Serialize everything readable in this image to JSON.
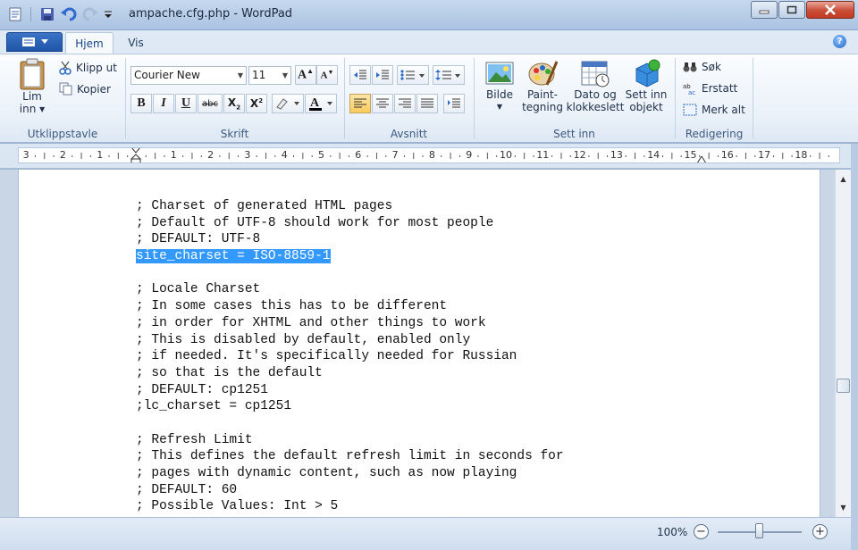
{
  "window": {
    "title": "ampache.cfg.php - WordPad",
    "accent": "#1f54a8"
  },
  "tabs": {
    "home": "Hjem",
    "view": "Vis"
  },
  "ribbon": {
    "clipboard": {
      "label": "Utklippstavle",
      "paste_line1": "Lim",
      "paste_line2": "inn",
      "cut": "Klipp ut",
      "copy": "Kopier"
    },
    "font": {
      "label": "Skrift",
      "family": "Courier New",
      "size": "11",
      "bold": "B",
      "italic": "I",
      "underline": "U",
      "strike": "abc"
    },
    "paragraph": {
      "label": "Avsnitt"
    },
    "insert": {
      "label": "Sett inn",
      "picture": "Bilde",
      "paint_line1": "Paint-",
      "paint_line2": "tegning",
      "date_line1": "Dato og",
      "date_line2": "klokkeslett",
      "object_line1": "Sett inn",
      "object_line2": "objekt"
    },
    "editing": {
      "label": "Redigering",
      "find": "Søk",
      "replace": "Erstatt",
      "select_all": "Merk alt"
    }
  },
  "ruler": {
    "labels": [
      "3",
      "2",
      "1",
      "1",
      "2",
      "3",
      "4",
      "5",
      "6",
      "7",
      "8",
      "9",
      "10",
      "11",
      "12",
      "13",
      "14",
      "15",
      "16",
      "17",
      "18"
    ]
  },
  "document": {
    "lines": [
      "; Charset of generated HTML pages",
      "; Default of UTF-8 should work for most people",
      "; DEFAULT: UTF-8",
      "site_charset = ISO-8859-1",
      "",
      "; Locale Charset",
      "; In some cases this has to be different",
      "; in order for XHTML and other things to work",
      "; This is disabled by default, enabled only",
      "; if needed. It's specifically needed for Russian",
      "; so that is the default",
      "; DEFAULT: cp1251",
      ";lc_charset = cp1251",
      "",
      "; Refresh Limit",
      "; This defines the default refresh limit in seconds for",
      "; pages with dynamic content, such as now playing",
      "; DEFAULT: 60",
      "; Possible Values: Int > 5"
    ],
    "selected_line": 3,
    "selection_color": "#3399ff"
  },
  "status": {
    "zoom": "100%",
    "zoom_out": "−",
    "zoom_in": "+"
  }
}
